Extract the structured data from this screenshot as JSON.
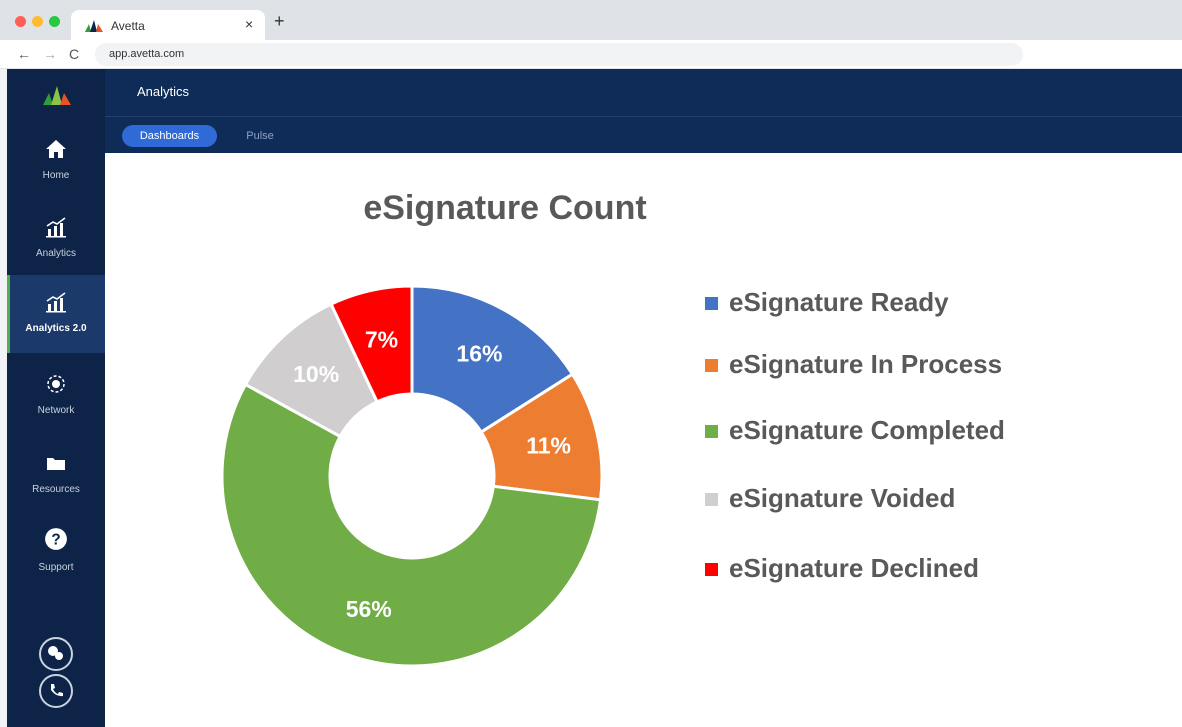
{
  "browser": {
    "tab_title": "Avetta",
    "tab_close": "×",
    "new_tab": "+",
    "url": "app.avetta.com",
    "nav": {
      "back": "←",
      "forward": "→",
      "reload": "C"
    }
  },
  "sidebar": {
    "items": [
      {
        "label": "Home",
        "icon": "home-icon"
      },
      {
        "label": "Analytics",
        "icon": "analytics-icon"
      },
      {
        "label": "Analytics 2.0",
        "icon": "analytics-icon",
        "active": true
      },
      {
        "label": "Network",
        "icon": "network-icon"
      },
      {
        "label": "Resources",
        "icon": "folder-icon"
      },
      {
        "label": "Support",
        "icon": "help-icon"
      }
    ],
    "bottom_icons": [
      "chat-icon",
      "phone-icon"
    ]
  },
  "header": {
    "title": "Analytics"
  },
  "tabs": [
    {
      "label": "Dashboards",
      "active": true
    },
    {
      "label": "Pulse",
      "active": false
    }
  ],
  "colors": {
    "ready": "#4472c4",
    "in_process": "#ed7d31",
    "completed": "#70ad47",
    "voided": "#d0cece",
    "declined": "#ff0000"
  },
  "chart_data": {
    "type": "pie",
    "title": "eSignature Count",
    "donut": true,
    "legend_position": "right",
    "categories": [
      "eSignature Ready",
      "eSignature In Process",
      "eSignature Completed",
      "eSignature Voided",
      "eSignature Declined"
    ],
    "values": [
      16,
      11,
      56,
      10,
      7
    ],
    "data_labels": [
      "16%",
      "11%",
      "56%",
      "10%",
      "7%"
    ],
    "colors": [
      "#4472c4",
      "#ed7d31",
      "#70ad47",
      "#d0cece",
      "#ff0000"
    ]
  }
}
